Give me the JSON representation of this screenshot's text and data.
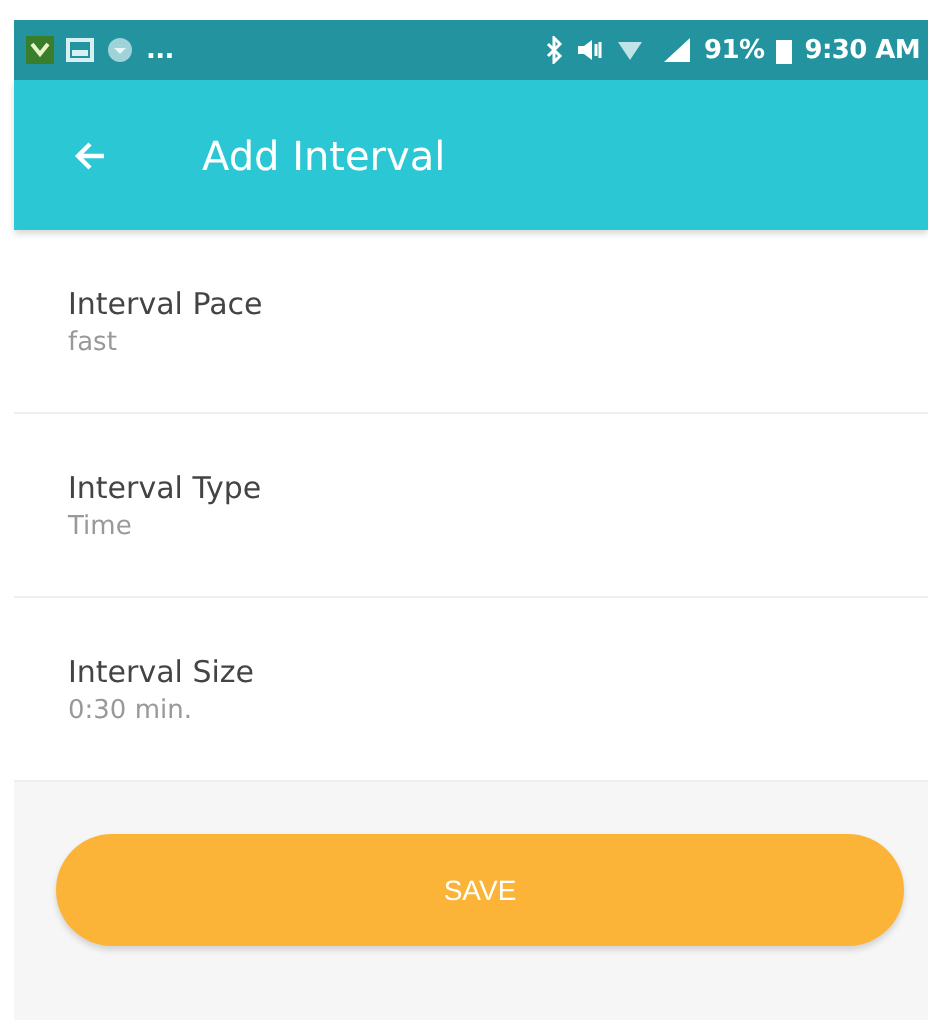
{
  "status_bar": {
    "more": "...",
    "battery": "91%",
    "time": "9:30 AM"
  },
  "app_bar": {
    "title": "Add Interval"
  },
  "settings": [
    {
      "label": "Interval Pace",
      "value": "fast"
    },
    {
      "label": "Interval Type",
      "value": "Time"
    },
    {
      "label": "Interval Size",
      "value": "0:30 min."
    }
  ],
  "button": {
    "label": "SAVE"
  }
}
